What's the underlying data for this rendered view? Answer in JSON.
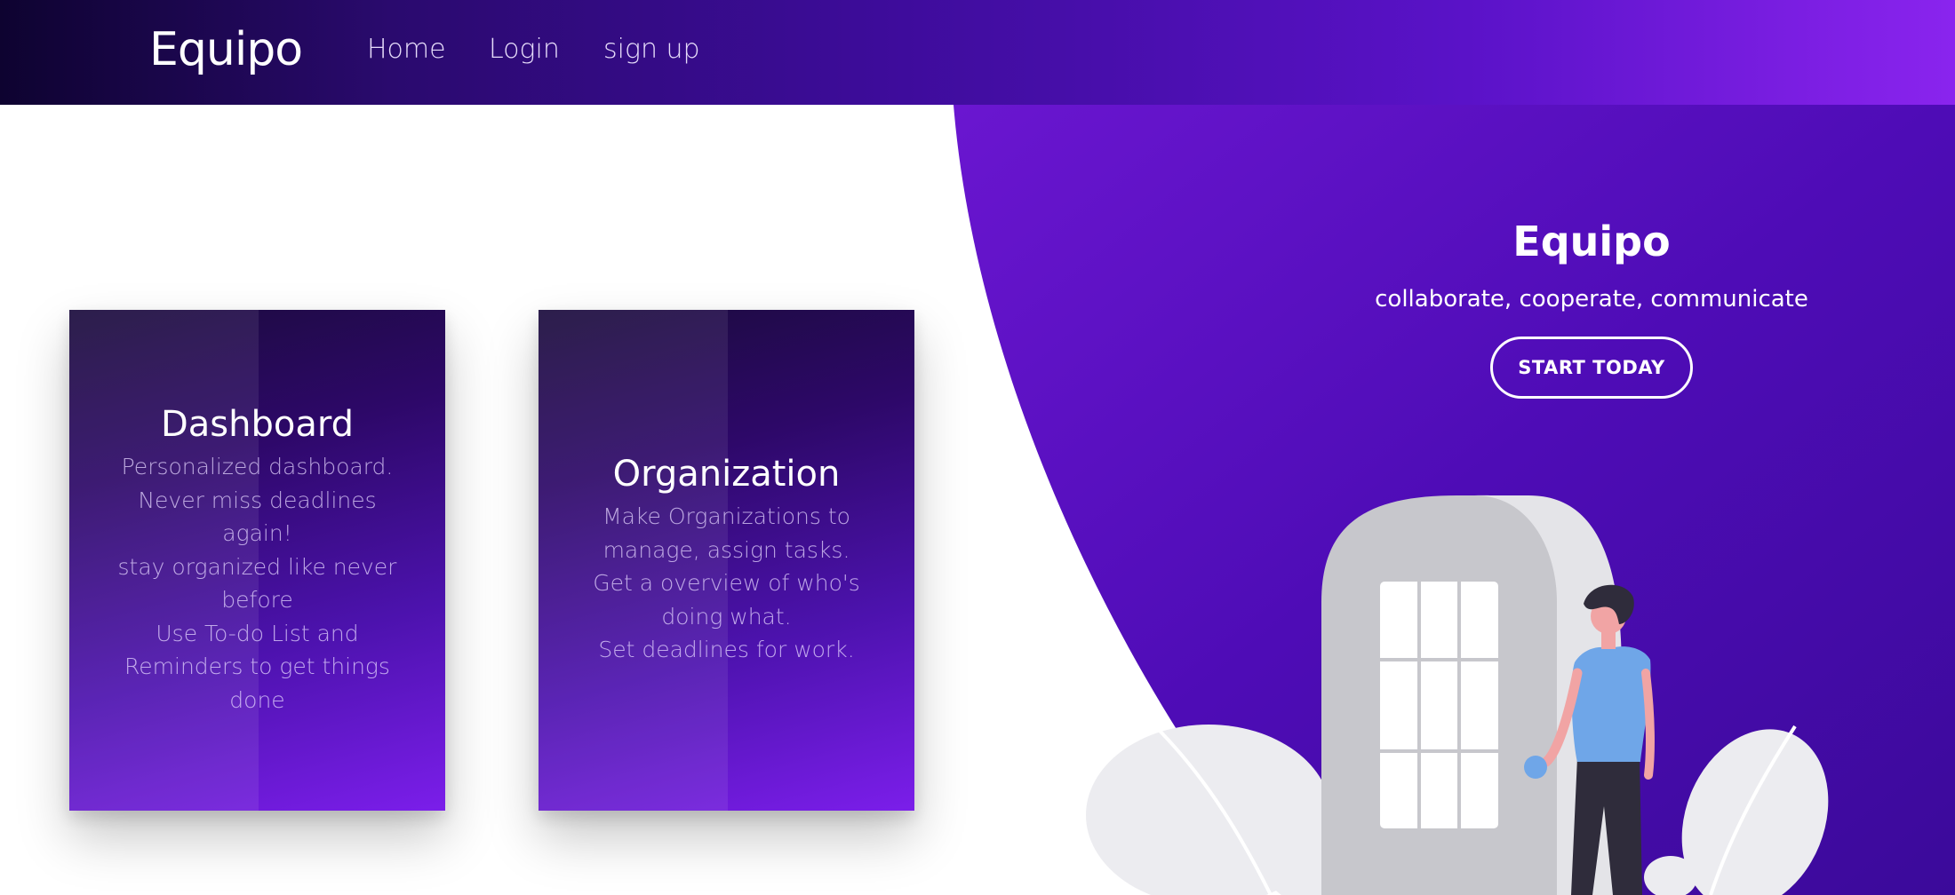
{
  "navbar": {
    "brand": "Equipo",
    "links": [
      {
        "label": "Home"
      },
      {
        "label": "Login"
      },
      {
        "label": "sign up"
      }
    ]
  },
  "hero": {
    "title": "Equipo",
    "subtitle": "collaborate, cooperate, communicate",
    "button_label": "START TODAY"
  },
  "cards": [
    {
      "title": "Dashboard",
      "lines": [
        "Personalized dashboard.",
        "Never miss deadlines",
        "again!",
        "stay organized like never",
        "before",
        "Use To-do List and",
        "Reminders to get things",
        "done"
      ]
    },
    {
      "title": "Organization",
      "lines": [
        "Make Organizations to",
        "manage, assign tasks.",
        "Get a overview of who's",
        "doing what.",
        "Set deadlines for work."
      ]
    }
  ],
  "colors": {
    "navbar_dark": "#0e0330",
    "navbar_light": "#8a24ee",
    "hero_purple": "#4a0cb0",
    "button_border": "#ffffff"
  }
}
